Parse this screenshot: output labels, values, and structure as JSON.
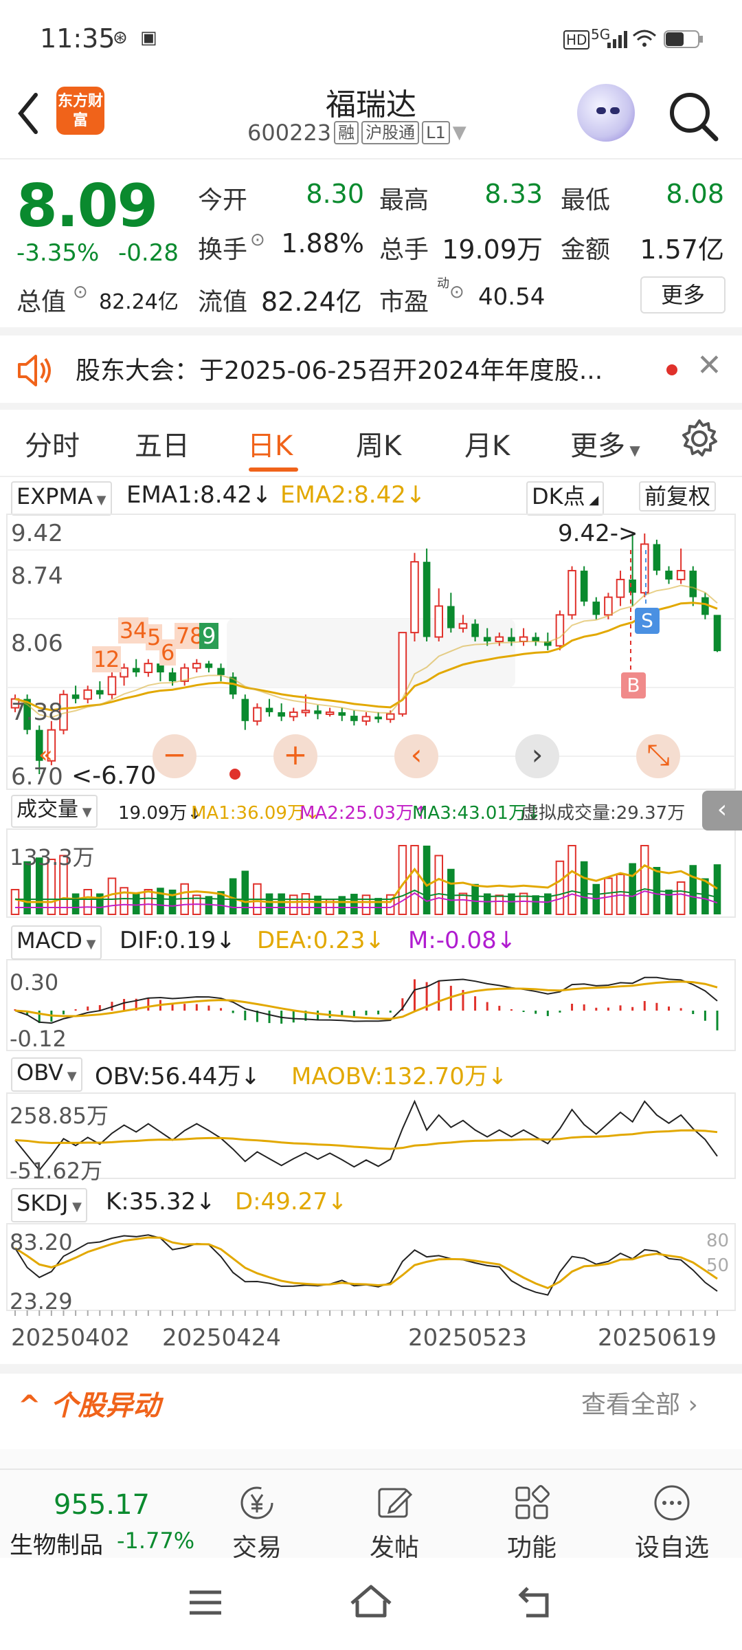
{
  "status_bar": {
    "time": "11:35",
    "signal": "5G",
    "hd": "HD"
  },
  "header": {
    "title": "福瑞达",
    "code": "600223",
    "tag1": "融",
    "tag2": "沪股通",
    "tag3": "L1",
    "logo_text": "东方财富"
  },
  "quote": {
    "price": "8.09",
    "change_pct": "-3.35%",
    "change": "-0.28",
    "open_label": "今开",
    "open": "8.30",
    "high_label": "最高",
    "high": "8.33",
    "low_label": "最低",
    "low": "8.08",
    "turnover_label": "换手",
    "turnover": "1.88%",
    "volume_label": "总手",
    "volume": "19.09万",
    "amount_label": "金额",
    "amount": "1.57亿",
    "total_cap_label": "总值",
    "total_cap": "82.24亿",
    "float_cap_label": "流值",
    "float_cap": "82.24亿",
    "pe_label": "市盈",
    "pe_sup": "动",
    "pe": "40.54",
    "more_label": "更多"
  },
  "notice": {
    "text": "股东大会：于2025-06-25召开2024年年度股..."
  },
  "tabs": [
    "分时",
    "五日",
    "日K",
    "周K",
    "月K",
    "更多"
  ],
  "active_tab": "日K",
  "kline": {
    "indicator": "EXPMA",
    "ema1": "EMA1:8.42",
    "ema2": "EMA2:8.42",
    "dk_label": "DK点",
    "adjust_label": "前复权",
    "y_labels": [
      "9.42",
      "8.74",
      "8.06",
      "7.38",
      "6.70"
    ],
    "max_marker": "9.42->",
    "min_marker": "<-6.70",
    "nine_turn": [
      "1",
      "2",
      "3",
      "4",
      "5",
      "6",
      "7",
      "8",
      "9"
    ],
    "s_label": "S",
    "b_label": "B",
    "controls": [
      "−",
      "+",
      "‹",
      "›",
      "⤡"
    ]
  },
  "volume_panel": {
    "indicator": "成交量",
    "vol": "19.09万",
    "ma1": "MA1:36.09万",
    "ma2": "MA2:25.03万",
    "ma3": "MA3:43.01万",
    "virtual": "虚拟成交量:29.37万",
    "y_label": "133.3万"
  },
  "macd_panel": {
    "indicator": "MACD",
    "dif": "DIF:0.19",
    "dea": "DEA:0.23",
    "m": "M:-0.08",
    "y_top": "0.30",
    "y_bottom": "-0.12"
  },
  "obv_panel": {
    "indicator": "OBV",
    "obv": "OBV:56.44万",
    "maobv": "MAOBV:132.70万",
    "y_top": "258.85万",
    "y_bottom": "-51.62万"
  },
  "skdj_panel": {
    "indicator": "SKDJ",
    "k": "K:35.32",
    "d": "D:49.27",
    "y_top": "83.20",
    "y_bottom": "23.29",
    "right_top": "80",
    "right_mid": "50"
  },
  "dates": [
    "20250402",
    "20250424",
    "20250523",
    "20250619"
  ],
  "section": {
    "title": "个股异动",
    "more": "查看全部"
  },
  "bottom_bar": {
    "index_value": "955.17",
    "index_name": "生物制品",
    "index_change": "-1.77%",
    "items": [
      "交易",
      "发帖",
      "功能",
      "设自选"
    ]
  },
  "colors": {
    "up": "#e0312b",
    "down": "#0a8a2e",
    "accent": "#f0631a",
    "ema2": "#e2a800"
  },
  "chart_data": {
    "type": "candlestick",
    "dates_shown": [
      "20250402",
      "20250424",
      "20250523",
      "20250619"
    ],
    "ylim": [
      6.7,
      9.42
    ],
    "candles": [
      [
        7.45,
        7.55,
        7.4,
        7.6
      ],
      [
        7.55,
        7.2,
        7.15,
        7.6
      ],
      [
        7.2,
        6.85,
        6.7,
        7.25
      ],
      [
        6.85,
        7.2,
        6.8,
        7.3
      ],
      [
        7.2,
        7.6,
        7.15,
        7.65
      ],
      [
        7.6,
        7.55,
        7.5,
        7.7
      ],
      [
        7.55,
        7.65,
        7.5,
        7.7
      ],
      [
        7.65,
        7.6,
        7.55,
        7.75
      ],
      [
        7.6,
        7.8,
        7.55,
        7.85
      ],
      [
        7.8,
        7.9,
        7.7,
        7.95
      ],
      [
        7.9,
        7.85,
        7.8,
        8.0
      ],
      [
        7.85,
        7.95,
        7.8,
        8.0
      ],
      [
        7.95,
        7.85,
        7.75,
        8.0
      ],
      [
        7.85,
        7.75,
        7.7,
        7.9
      ],
      [
        7.75,
        7.9,
        7.7,
        7.95
      ],
      [
        7.9,
        7.95,
        7.85,
        8.0
      ],
      [
        7.95,
        7.9,
        7.85,
        7.98
      ],
      [
        7.9,
        7.82,
        7.75,
        7.95
      ],
      [
        7.8,
        7.6,
        7.55,
        7.85
      ],
      [
        7.55,
        7.3,
        7.2,
        7.6
      ],
      [
        7.3,
        7.45,
        7.25,
        7.5
      ],
      [
        7.45,
        7.4,
        7.35,
        7.55
      ],
      [
        7.4,
        7.35,
        7.3,
        7.5
      ],
      [
        7.35,
        7.4,
        7.3,
        7.45
      ],
      [
        7.4,
        7.42,
        7.35,
        7.6
      ],
      [
        7.42,
        7.38,
        7.32,
        7.48
      ],
      [
        7.38,
        7.4,
        7.35,
        7.45
      ],
      [
        7.4,
        7.36,
        7.3,
        7.45
      ],
      [
        7.36,
        7.3,
        7.25,
        7.42
      ],
      [
        7.3,
        7.35,
        7.25,
        7.4
      ],
      [
        7.35,
        7.32,
        7.28,
        7.4
      ],
      [
        7.32,
        7.38,
        7.28,
        7.42
      ],
      [
        7.38,
        8.3,
        7.35,
        8.3
      ],
      [
        8.3,
        9.1,
        8.2,
        9.2
      ],
      [
        9.1,
        8.25,
        8.2,
        9.25
      ],
      [
        8.25,
        8.6,
        8.2,
        8.8
      ],
      [
        8.6,
        8.35,
        8.3,
        8.75
      ],
      [
        8.35,
        8.4,
        8.3,
        8.5
      ],
      [
        8.4,
        8.25,
        8.2,
        8.45
      ],
      [
        8.25,
        8.2,
        8.15,
        8.35
      ],
      [
        8.2,
        8.25,
        8.15,
        8.3
      ],
      [
        8.25,
        8.2,
        8.15,
        8.35
      ],
      [
        8.2,
        8.25,
        8.15,
        8.35
      ],
      [
        8.25,
        8.2,
        8.15,
        8.3
      ],
      [
        8.2,
        8.15,
        8.1,
        8.3
      ],
      [
        8.15,
        8.5,
        8.1,
        8.55
      ],
      [
        8.5,
        9.0,
        8.45,
        9.05
      ],
      [
        9.0,
        8.65,
        8.6,
        9.05
      ],
      [
        8.65,
        8.5,
        8.45,
        8.7
      ],
      [
        8.5,
        8.7,
        8.45,
        8.75
      ],
      [
        8.7,
        8.9,
        8.6,
        9.0
      ],
      [
        8.9,
        8.75,
        8.6,
        9.4
      ],
      [
        8.75,
        9.3,
        8.7,
        9.42
      ],
      [
        9.3,
        9.0,
        8.95,
        9.35
      ],
      [
        9.0,
        8.9,
        8.85,
        9.05
      ],
      [
        8.9,
        9.0,
        8.85,
        9.25
      ],
      [
        9.0,
        8.7,
        8.6,
        9.05
      ],
      [
        8.7,
        8.5,
        8.45,
        8.75
      ],
      [
        8.5,
        8.09,
        8.08,
        8.33
      ]
    ]
  }
}
